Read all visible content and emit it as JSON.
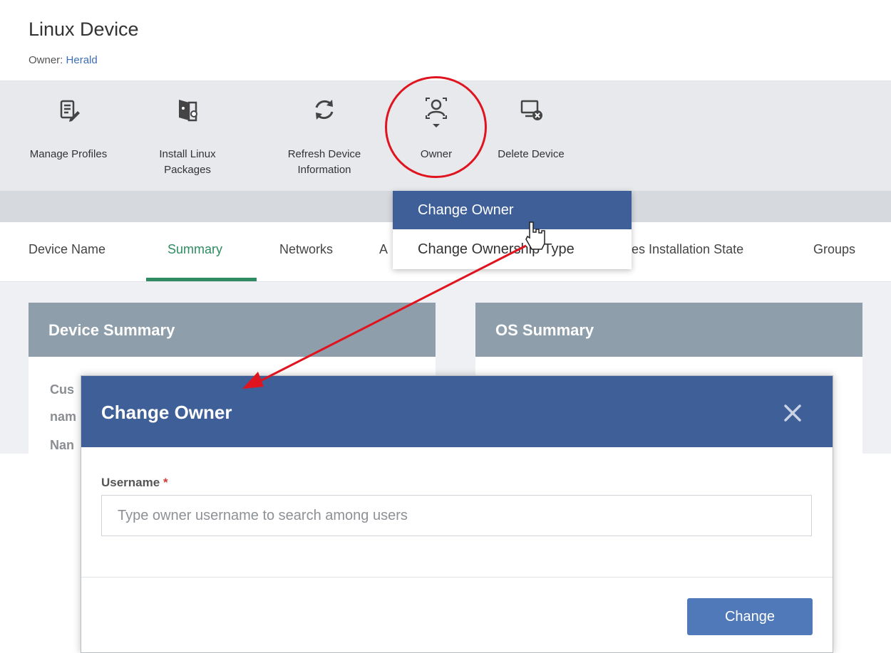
{
  "header": {
    "title": "Linux Device",
    "owner_label": "Owner:",
    "owner_name": "Herald"
  },
  "toolbar": {
    "items": [
      {
        "label": "Manage Profiles",
        "icon": "manage-profiles-icon"
      },
      {
        "label": "Install Linux Packages",
        "icon": "install-linux-packages-icon"
      },
      {
        "label": "Refresh Device Information",
        "icon": "refresh-icon"
      },
      {
        "label": "Owner",
        "icon": "owner-icon"
      },
      {
        "label": "Delete Device",
        "icon": "delete-device-icon"
      }
    ]
  },
  "owner_menu": {
    "items": [
      "Change Owner",
      "Change Ownership Type"
    ]
  },
  "tabs": {
    "items": [
      "Device Name",
      "Summary",
      "Networks",
      "A",
      "es Installation State",
      "Groups"
    ],
    "active": "Summary"
  },
  "panels": {
    "device_summary": {
      "title": "Device Summary",
      "rows": [
        "Cus",
        "nam",
        "Nan"
      ]
    },
    "os_summary": {
      "title": "OS Summary"
    }
  },
  "modal": {
    "title": "Change Owner",
    "field_label": "Username",
    "required_mark": "*",
    "placeholder": "Type owner username to search among users",
    "value": "",
    "button_label": "Change"
  },
  "colors": {
    "primary": "#3e5f98",
    "button": "#5079b9",
    "active_tab": "#2e8b62",
    "annotation": "#e0141f"
  }
}
